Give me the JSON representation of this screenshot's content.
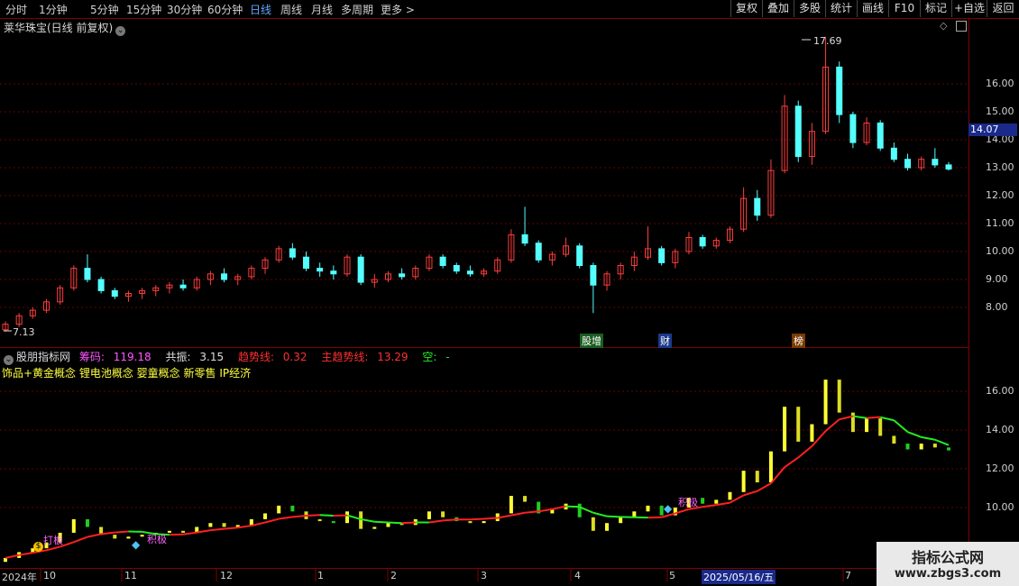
{
  "toolbar": {
    "timeframes": [
      "分时",
      "1分钟",
      "5分钟",
      "15分钟",
      "30分钟",
      "60分钟",
      "日线",
      "周线",
      "月线",
      "多周期",
      "更多 >"
    ],
    "active_timeframe": "日线",
    "buttons": [
      "复权",
      "叠加",
      "多股",
      "统计",
      "画线",
      "F10",
      "标记",
      "+自选",
      "返回"
    ]
  },
  "main_chart": {
    "title": "莱华珠宝(日线 前复权)",
    "price_axis": [
      "16.00",
      "15.00",
      "14.00",
      "13.00",
      "12.00",
      "11.00",
      "10.00",
      "9.00",
      "8.00"
    ],
    "current_price_tag": "14.07",
    "high_label": "17.69",
    "low_label": "7.13",
    "event_tags": [
      "股增",
      "财",
      "榜"
    ],
    "colors": {
      "up": "#ff3c3c",
      "down": "#54ffff",
      "grid": "#800000"
    }
  },
  "indicator": {
    "name": "股朋指标网",
    "chouma_label": "筹码: ",
    "chouma_value": "119.18",
    "gongzhen_label": "共振: ",
    "gongzhen_value": "3.15",
    "qushi_label": "趋势线: ",
    "qushi_value": "0.32",
    "zhuqushi_label": "主趋势线: ",
    "zhuqushi_value": "13.29",
    "kong_label": "空: ",
    "kong_value": "-",
    "concepts": "饰品+黄金概念 锂电池概念 婴童概念 新零售 IP经济",
    "price_axis": [
      "16.00",
      "14.00",
      "12.00",
      "10.00"
    ],
    "signals": [
      "打板",
      "积极",
      "积极"
    ],
    "colors": {
      "chouma": "#ff55ff",
      "gongzhen": "#dddddd",
      "qushi": "#ff3030",
      "zhuqushi": "#ff3030",
      "kong": "#22ee22",
      "concepts": "#ffff40"
    }
  },
  "time_axis": {
    "labels": [
      "2024年",
      "10",
      "11",
      "12",
      "1",
      "2",
      "3",
      "4",
      "5",
      "2025/05/16/五",
      "7"
    ],
    "highlight": "2025/05/16/五"
  },
  "watermark": {
    "line1": "指标公式网",
    "line2": "www.zbgs3.com"
  },
  "chart_data": {
    "type": "candlestick",
    "title": "莱华珠宝(日线 前复权)",
    "x_range": [
      "2024-09",
      "2025-07"
    ],
    "y_range": [
      7.13,
      17.69
    ],
    "ohlc_approx": [
      {
        "o": 7.2,
        "h": 7.5,
        "l": 7.13,
        "c": 7.4
      },
      {
        "o": 7.4,
        "h": 7.8,
        "l": 7.3,
        "c": 7.7
      },
      {
        "o": 7.7,
        "h": 8.0,
        "l": 7.6,
        "c": 7.9
      },
      {
        "o": 7.9,
        "h": 8.3,
        "l": 7.8,
        "c": 8.2
      },
      {
        "o": 8.2,
        "h": 8.8,
        "l": 8.1,
        "c": 8.7
      },
      {
        "o": 8.7,
        "h": 9.5,
        "l": 8.6,
        "c": 9.4
      },
      {
        "o": 9.4,
        "h": 9.9,
        "l": 8.9,
        "c": 9.0
      },
      {
        "o": 9.0,
        "h": 9.1,
        "l": 8.5,
        "c": 8.6
      },
      {
        "o": 8.6,
        "h": 8.7,
        "l": 8.3,
        "c": 8.4
      },
      {
        "o": 8.4,
        "h": 8.6,
        "l": 8.2,
        "c": 8.5
      },
      {
        "o": 8.5,
        "h": 8.7,
        "l": 8.3,
        "c": 8.6
      },
      {
        "o": 8.6,
        "h": 8.8,
        "l": 8.4,
        "c": 8.7
      },
      {
        "o": 8.7,
        "h": 8.9,
        "l": 8.5,
        "c": 8.8
      },
      {
        "o": 8.8,
        "h": 9.0,
        "l": 8.6,
        "c": 8.7
      },
      {
        "o": 8.7,
        "h": 9.1,
        "l": 8.6,
        "c": 9.0
      },
      {
        "o": 9.0,
        "h": 9.3,
        "l": 8.8,
        "c": 9.2
      },
      {
        "o": 9.2,
        "h": 9.4,
        "l": 8.9,
        "c": 9.0
      },
      {
        "o": 9.0,
        "h": 9.2,
        "l": 8.8,
        "c": 9.1
      },
      {
        "o": 9.1,
        "h": 9.5,
        "l": 9.0,
        "c": 9.4
      },
      {
        "o": 9.4,
        "h": 9.8,
        "l": 9.2,
        "c": 9.7
      },
      {
        "o": 9.7,
        "h": 10.2,
        "l": 9.6,
        "c": 10.1
      },
      {
        "o": 10.1,
        "h": 10.3,
        "l": 9.7,
        "c": 9.8
      },
      {
        "o": 9.8,
        "h": 10.0,
        "l": 9.3,
        "c": 9.4
      },
      {
        "o": 9.4,
        "h": 9.6,
        "l": 9.1,
        "c": 9.3
      },
      {
        "o": 9.3,
        "h": 9.5,
        "l": 9.0,
        "c": 9.2
      },
      {
        "o": 9.2,
        "h": 9.9,
        "l": 9.1,
        "c": 9.8
      },
      {
        "o": 9.8,
        "h": 9.9,
        "l": 8.8,
        "c": 8.9
      },
      {
        "o": 8.9,
        "h": 9.2,
        "l": 8.7,
        "c": 9.0
      },
      {
        "o": 9.0,
        "h": 9.3,
        "l": 8.9,
        "c": 9.2
      },
      {
        "o": 9.2,
        "h": 9.4,
        "l": 9.0,
        "c": 9.1
      },
      {
        "o": 9.1,
        "h": 9.5,
        "l": 9.0,
        "c": 9.4
      },
      {
        "o": 9.4,
        "h": 9.9,
        "l": 9.3,
        "c": 9.8
      },
      {
        "o": 9.8,
        "h": 9.9,
        "l": 9.4,
        "c": 9.5
      },
      {
        "o": 9.5,
        "h": 9.6,
        "l": 9.2,
        "c": 9.3
      },
      {
        "o": 9.3,
        "h": 9.5,
        "l": 9.1,
        "c": 9.2
      },
      {
        "o": 9.2,
        "h": 9.4,
        "l": 9.1,
        "c": 9.3
      },
      {
        "o": 9.3,
        "h": 9.8,
        "l": 9.2,
        "c": 9.7
      },
      {
        "o": 9.7,
        "h": 10.8,
        "l": 9.6,
        "c": 10.6
      },
      {
        "o": 10.6,
        "h": 11.6,
        "l": 10.2,
        "c": 10.3
      },
      {
        "o": 10.3,
        "h": 10.4,
        "l": 9.6,
        "c": 9.7
      },
      {
        "o": 9.7,
        "h": 10.0,
        "l": 9.5,
        "c": 9.9
      },
      {
        "o": 9.9,
        "h": 10.5,
        "l": 9.8,
        "c": 10.2
      },
      {
        "o": 10.2,
        "h": 10.3,
        "l": 9.4,
        "c": 9.5
      },
      {
        "o": 9.5,
        "h": 9.6,
        "l": 7.8,
        "c": 8.8
      },
      {
        "o": 8.8,
        "h": 9.3,
        "l": 8.6,
        "c": 9.2
      },
      {
        "o": 9.2,
        "h": 9.6,
        "l": 9.0,
        "c": 9.5
      },
      {
        "o": 9.5,
        "h": 10.0,
        "l": 9.3,
        "c": 9.8
      },
      {
        "o": 9.8,
        "h": 10.9,
        "l": 9.7,
        "c": 10.1
      },
      {
        "o": 10.1,
        "h": 10.2,
        "l": 9.5,
        "c": 9.6
      },
      {
        "o": 9.6,
        "h": 10.1,
        "l": 9.4,
        "c": 10.0
      },
      {
        "o": 10.0,
        "h": 10.7,
        "l": 9.9,
        "c": 10.5
      },
      {
        "o": 10.5,
        "h": 10.6,
        "l": 10.1,
        "c": 10.2
      },
      {
        "o": 10.2,
        "h": 10.5,
        "l": 10.1,
        "c": 10.4
      },
      {
        "o": 10.4,
        "h": 10.9,
        "l": 10.3,
        "c": 10.8
      },
      {
        "o": 10.8,
        "h": 12.3,
        "l": 10.7,
        "c": 11.9
      },
      {
        "o": 11.9,
        "h": 12.2,
        "l": 11.1,
        "c": 11.3
      },
      {
        "o": 11.3,
        "h": 13.3,
        "l": 11.2,
        "c": 12.9
      },
      {
        "o": 12.9,
        "h": 15.6,
        "l": 12.8,
        "c": 15.2
      },
      {
        "o": 15.2,
        "h": 15.4,
        "l": 13.2,
        "c": 13.4
      },
      {
        "o": 13.4,
        "h": 14.6,
        "l": 13.1,
        "c": 14.3
      },
      {
        "o": 14.3,
        "h": 17.69,
        "l": 14.2,
        "c": 16.6
      },
      {
        "o": 16.6,
        "h": 16.8,
        "l": 14.6,
        "c": 14.9
      },
      {
        "o": 14.9,
        "h": 15.0,
        "l": 13.7,
        "c": 13.9
      },
      {
        "o": 13.9,
        "h": 14.8,
        "l": 13.8,
        "c": 14.6
      },
      {
        "o": 14.6,
        "h": 14.7,
        "l": 13.6,
        "c": 13.7
      },
      {
        "o": 13.7,
        "h": 13.9,
        "l": 13.2,
        "c": 13.3
      },
      {
        "o": 13.3,
        "h": 13.5,
        "l": 12.9,
        "c": 13.0
      },
      {
        "o": 13.0,
        "h": 13.4,
        "l": 12.9,
        "c": 13.3
      },
      {
        "o": 13.3,
        "h": 13.7,
        "l": 13.0,
        "c": 13.1
      },
      {
        "o": 13.1,
        "h": 13.2,
        "l": 12.9,
        "c": 12.95
      }
    ]
  }
}
